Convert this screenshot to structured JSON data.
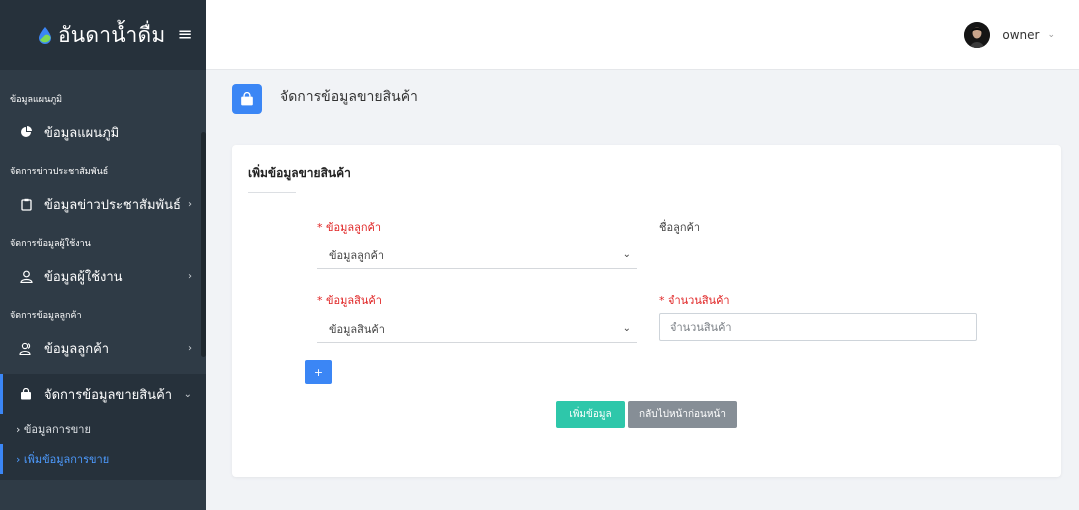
{
  "brand": {
    "title": "อันดาน้ำดื่ม",
    "menu_icon": "hamburger-icon"
  },
  "sidebar": {
    "sections": [
      {
        "title": "ข้อมูลแผนภูมิ",
        "item": {
          "label": "ข้อมูลแผนภูมิ",
          "icon": "pie-chart-icon"
        }
      },
      {
        "title": "จัดการข่าวประชาสัมพันธ์",
        "item": {
          "label": "ข้อมูลข่าวประชาสัมพันธ์",
          "icon": "clipboard-icon"
        }
      },
      {
        "title": "จัดการข้อมูลผู้ใช้งาน",
        "item": {
          "label": "ข้อมูลผู้ใช้งาน",
          "icon": "user-icon"
        }
      },
      {
        "title": "จัดการข้อมูลลูกค้า",
        "item": {
          "label": "ข้อมูลลูกค้า",
          "icon": "users-icon"
        }
      }
    ],
    "active_item": {
      "label": "จัดการข้อมูลขายสินค้า",
      "icon": "shopping-bag-icon"
    },
    "submenu": [
      {
        "label": "› ข้อมูลการขาย"
      },
      {
        "label": "› เพิ่มข้อมูลการขาย"
      }
    ]
  },
  "user": {
    "name": "owner"
  },
  "page": {
    "title": "จัดการข้อมูลขายสินค้า"
  },
  "form": {
    "title": "เพิ่มข้อมูลขายสินค้า",
    "customer": {
      "label": "* ข้อมูลลูกค้า",
      "value": "ข้อมูลลูกค้า"
    },
    "customer_name": {
      "label": "ชื่อลูกค้า"
    },
    "product": {
      "label": "* ข้อมูลสินค้า",
      "value": "ข้อมูลสินค้า"
    },
    "quantity": {
      "label": "* จำนวนสินค้า",
      "placeholder": "จำนวนสินค้า"
    },
    "plus_label": "+",
    "submit_label": "เพิ่มข้อมูล",
    "back_label": "กลับไปหน้าก่อนหน้า"
  },
  "colors": {
    "sidebar_bg": "#2f3b46",
    "accent": "#3b86f5",
    "submit": "#2ec7aa",
    "back": "#868e96",
    "required": "#e02424"
  }
}
